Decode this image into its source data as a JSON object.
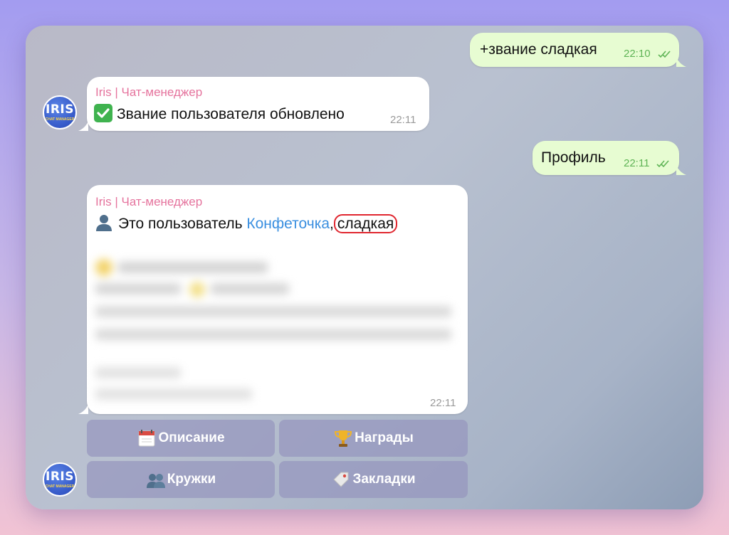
{
  "chat": {
    "messages": [
      {
        "direction": "out",
        "text": "+звание сладкая",
        "time": "22:10",
        "status": "read"
      },
      {
        "direction": "in",
        "sender": "Iris | Чат-менеджер",
        "text": "Звание пользователя обновлено",
        "time": "22:11",
        "emoji": "check-mark"
      },
      {
        "direction": "out",
        "text": "Профиль",
        "time": "22:11",
        "status": "read"
      },
      {
        "direction": "in",
        "sender": "Iris | Чат-менеджер",
        "text_prefix": "Это пользователь",
        "user_link": "Конфеточка",
        "separator": ",",
        "rank": "сладкая",
        "emoji": "user-silhouette",
        "time": "22:11"
      }
    ],
    "bot_avatar": {
      "text": "IRIS",
      "subtext": "CHAT MANAGER"
    }
  },
  "keyboard": {
    "buttons": [
      {
        "label": "Описание",
        "icon": "calendar-icon"
      },
      {
        "label": "Награды",
        "icon": "trophy-icon"
      },
      {
        "label": "Кружки",
        "icon": "users-icon"
      },
      {
        "label": "Закладки",
        "icon": "bookmark-tag-icon"
      }
    ]
  },
  "colors": {
    "outgoing_bubble": "#e7fcd2",
    "incoming_bubble": "#ffffff",
    "sender_name": "#e5739d",
    "user_link": "#3a8fe0",
    "read_ticks": "#5fb456",
    "highlight_circle": "#e0262f"
  }
}
